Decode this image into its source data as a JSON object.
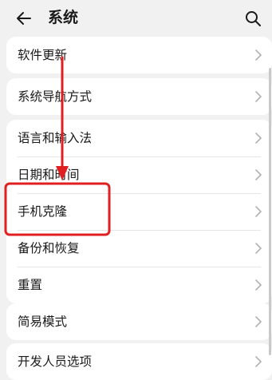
{
  "header": {
    "title": "系统"
  },
  "groups": [
    {
      "items": [
        "软件更新"
      ]
    },
    {
      "items": [
        "系统导航方式"
      ]
    },
    {
      "items": [
        "语言和输入法",
        "日期和时间",
        "手机克隆",
        "备份和恢复",
        "重置"
      ]
    },
    {
      "items": [
        "简易模式"
      ]
    },
    {
      "items": [
        "开发人员选项"
      ]
    }
  ],
  "annotation": {
    "color": "#e02020",
    "highlighted_item": "手机克隆"
  }
}
